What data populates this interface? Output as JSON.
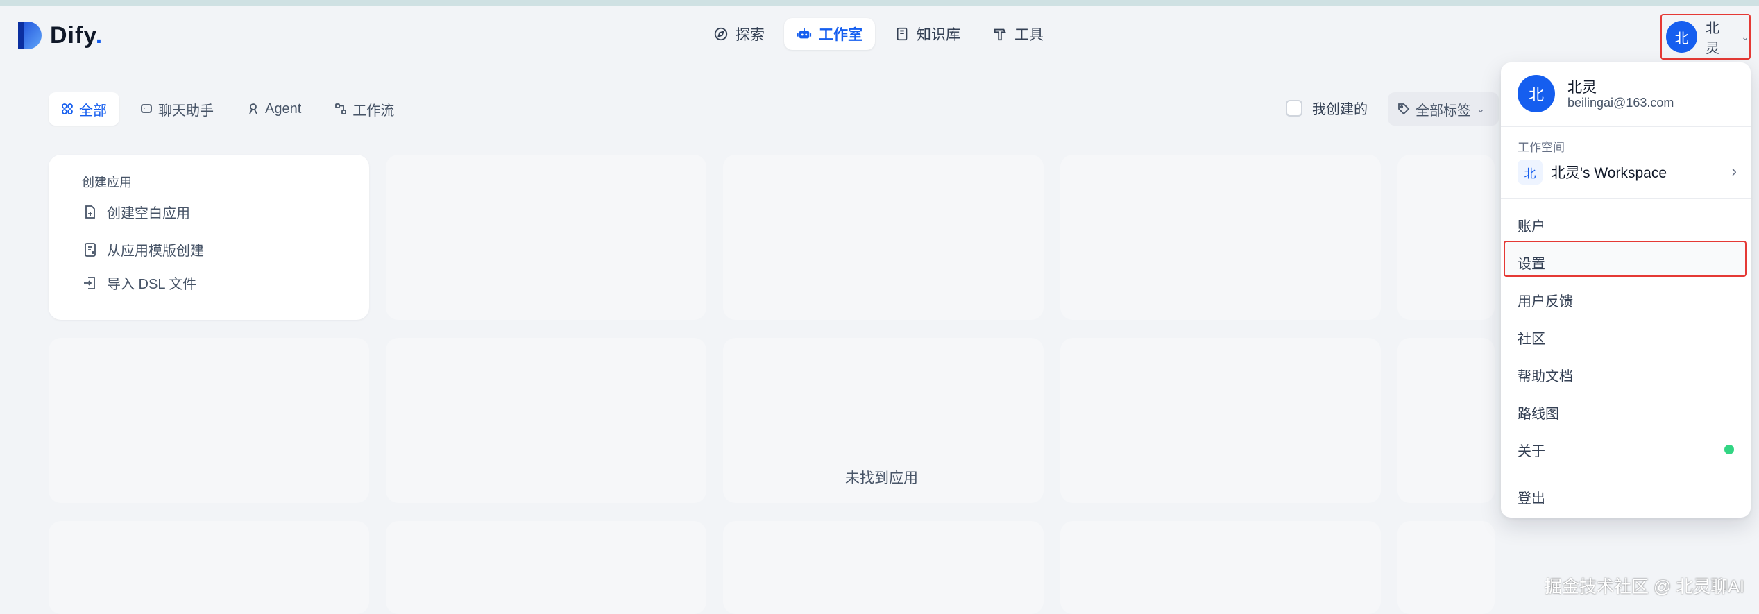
{
  "app": {
    "logo_text": "Dify",
    "logo_dot": "."
  },
  "nav": [
    {
      "label": "探索",
      "icon": "compass-icon",
      "active": false
    },
    {
      "label": "工作室",
      "icon": "robot-icon",
      "active": true
    },
    {
      "label": "知识库",
      "icon": "book-icon",
      "active": false
    },
    {
      "label": "工具",
      "icon": "hammer-icon",
      "active": false
    }
  ],
  "user": {
    "initial": "北",
    "name": "北灵",
    "email": "beilingai@163.com"
  },
  "filters": {
    "tabs": [
      "全部",
      "聊天助手",
      "Agent",
      "工作流"
    ],
    "mine_label": "我创建的",
    "tag_select": "全部标签"
  },
  "create_card": {
    "title": "创建应用",
    "items": [
      "创建空白应用",
      "从应用模版创建",
      "导入 DSL 文件"
    ]
  },
  "empty_state": "未找到应用",
  "dropdown": {
    "workspace_section": "工作空间",
    "workspace_initial": "北",
    "workspace_name": "北灵's Workspace",
    "menu": [
      "账户",
      "设置",
      "用户反馈",
      "社区",
      "帮助文档",
      "路线图",
      "关于",
      "登出"
    ]
  },
  "watermark": "掘金技术社区 @ 北灵聊AI",
  "colors": {
    "accent": "#155eef",
    "highlight": "#e53935",
    "status": "#32d583"
  }
}
